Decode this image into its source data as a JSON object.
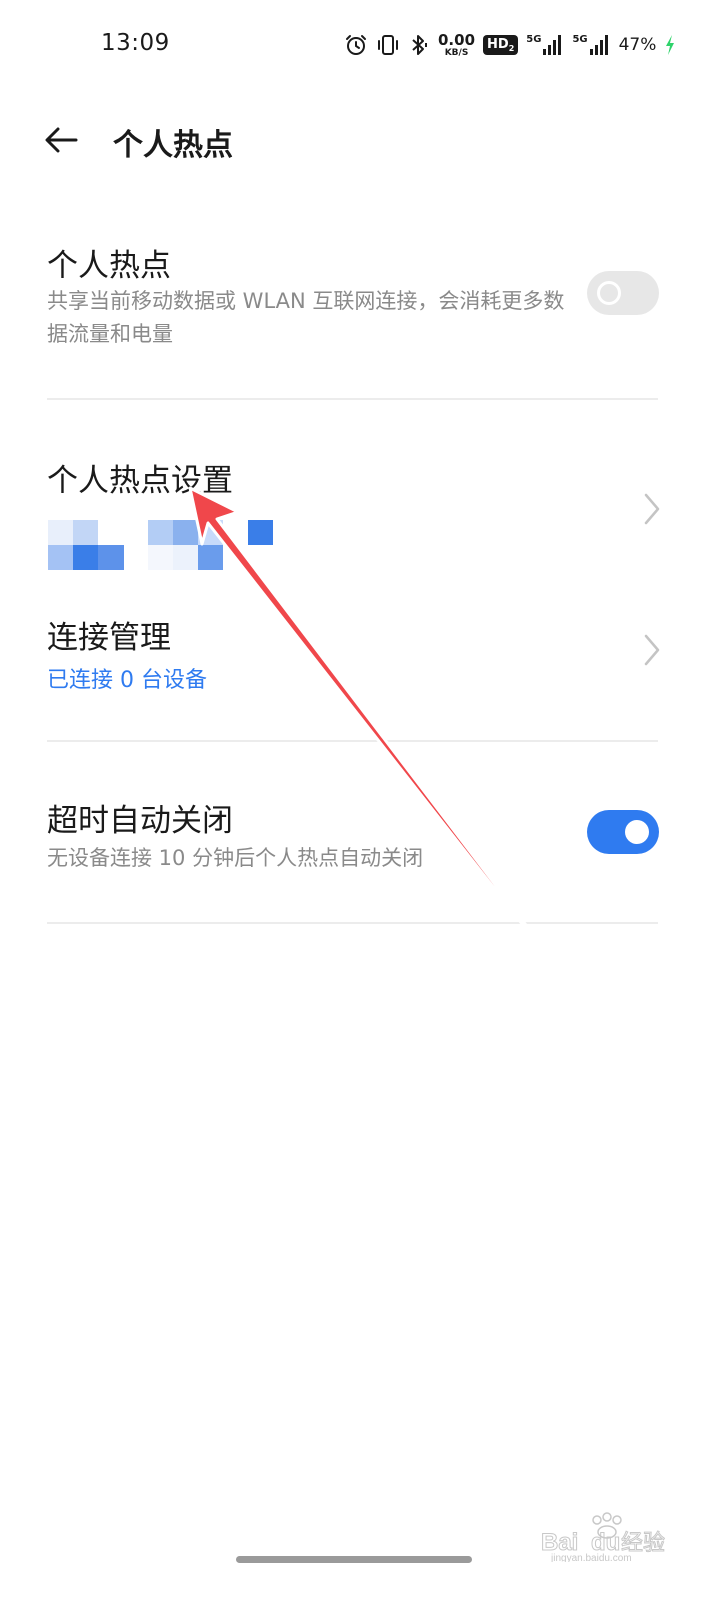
{
  "status_bar": {
    "time": "13:09",
    "net_speed_value": "0.00",
    "net_speed_unit": "KB/S",
    "hd_badge": "HD",
    "hd_badge_sub": "2",
    "sim1_label": "5G",
    "sim2_label": "5G",
    "battery": "47%",
    "icons": [
      "alarm-icon",
      "vibrate-icon",
      "bluetooth-icon",
      "hd-voice-icon",
      "signal-icon",
      "signal-icon",
      "charging-icon"
    ]
  },
  "header": {
    "title": "个人热点",
    "back_icon": "back-arrow-icon"
  },
  "hotspot": {
    "title": "个人热点",
    "description": "共享当前移动数据或 WLAN 互联网连接，会消耗更多数据流量和电量",
    "enabled": false
  },
  "hotspot_settings": {
    "title": "个人热点设置"
  },
  "connection_management": {
    "title": "连接管理",
    "status": "已连接 0 台设备"
  },
  "auto_off": {
    "title": "超时自动关闭",
    "description": "无设备连接 10 分钟后个人热点自动关闭",
    "enabled": true
  },
  "watermark": {
    "text": "Baidu 经验",
    "subtext": "jingyan.baidu.com"
  },
  "colors": {
    "accent": "#2f7bf0",
    "annotation_arrow": "#f0474b",
    "secondary_text": "#8a8a8a",
    "divider": "#ececec"
  }
}
